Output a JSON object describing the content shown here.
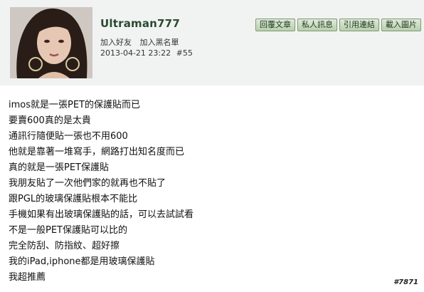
{
  "post": {
    "username": "Ultraman777",
    "user_links": [
      "加入好友",
      "加入黑名單"
    ],
    "timestamp": "2013-04-21 23:22",
    "post_number": "#55",
    "action_buttons": [
      "回覆文章",
      "私人訊息",
      "引用連結",
      "載入圖片"
    ],
    "body_lines": [
      "imos就是一張PET的保護貼而已",
      "要賣600真的是太貴",
      "通訊行隨便貼一張也不用600",
      "他就是靠著一堆寫手，網路打出知名度而已",
      "真的就是一張PET保護貼",
      "我朋友貼了一次他們家的就再也不貼了",
      "跟PGL的玻璃保護貼根本不能比",
      "手機如果有出玻璃保護貼的話，可以去試試看",
      "不是一般PET保護貼可以比的",
      "完全防刮、防指紋、超好擦",
      "我的iPad,iphone都是用玻璃保護貼",
      "我超推薦"
    ]
  },
  "watermark": "#7871",
  "colors": {
    "header_bg": "#f1f3f2",
    "button_bg": "#c9dbbf",
    "username": "#2b4a2f"
  }
}
